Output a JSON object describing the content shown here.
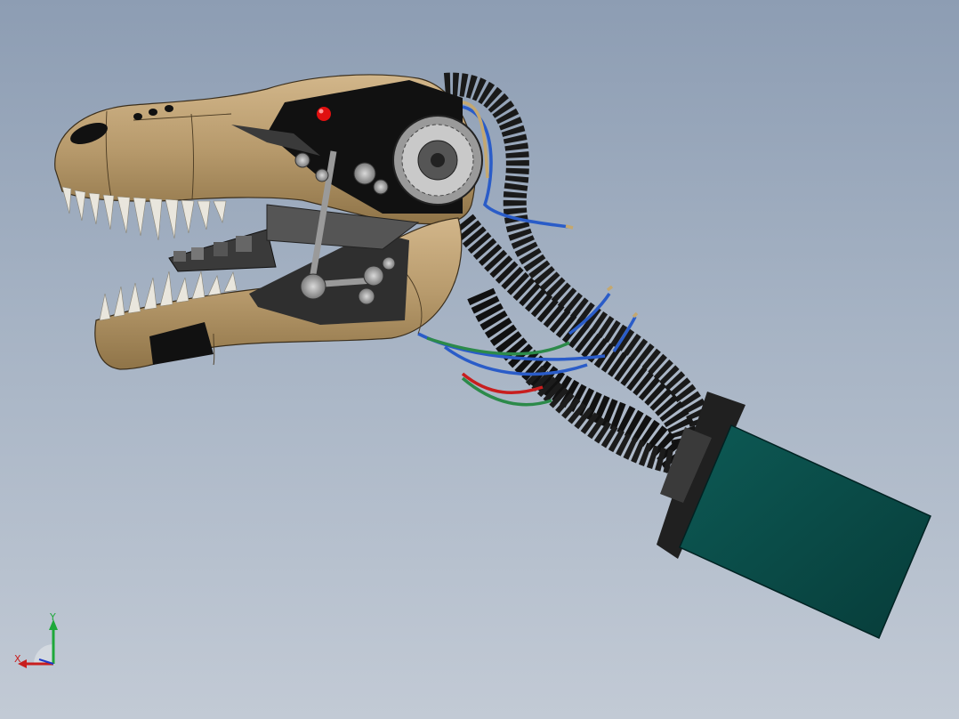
{
  "viewport": {
    "background_top": "#8d9db3",
    "background_bottom": "#c2cad5"
  },
  "model": {
    "skin_color": "#b79a6c",
    "metal_color": "#4a4a4a",
    "hose_color": "#1a1a1a",
    "eye_color": "#e01010",
    "base_color": "#0b4a47",
    "wire_colors": [
      "#2a5cc8",
      "#2c8a4a",
      "#c81e1e"
    ]
  },
  "triad": {
    "x_label": "X",
    "y_label": "Y",
    "x_color": "#c81e1e",
    "y_color": "#1ea83a",
    "z_color": "#1e3ac8"
  }
}
